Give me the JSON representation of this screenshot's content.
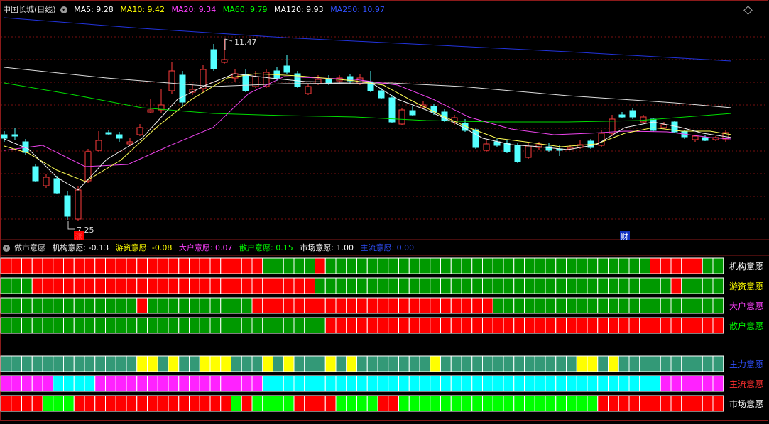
{
  "header": {
    "stock": "中国长城(日线)",
    "ma": [
      {
        "label": "MA5: 9.28",
        "color": "#ffffff"
      },
      {
        "label": "MA10: 9.42",
        "color": "#ffff00"
      },
      {
        "label": "MA20: 9.34",
        "color": "#ff40ff"
      },
      {
        "label": "MA60: 9.79",
        "color": "#00ff00"
      },
      {
        "label": "MA120: 9.93",
        "color": "#ffffff"
      },
      {
        "label": "MA250: 10.97",
        "color": "#3050ff"
      }
    ]
  },
  "main_chart": {
    "high_label": "11.47",
    "low_label": "7.25",
    "markers": [
      {
        "text": "涨",
        "color": "#ff4040"
      },
      {
        "text": "财",
        "color": "#ffffff"
      }
    ]
  },
  "indicator": {
    "name": "做市意愿",
    "items": [
      {
        "label": "机构意愿: -0.13",
        "color": "#ffffff"
      },
      {
        "label": "游资意愿: -0.08",
        "color": "#ffff00"
      },
      {
        "label": "大户意愿: 0.07",
        "color": "#ff40ff"
      },
      {
        "label": "散户意愿: 0.15",
        "color": "#00ff00"
      },
      {
        "label": "市场意愿: 1.00",
        "color": "#ffffff"
      },
      {
        "label": "主流意愿: 0.00",
        "color": "#3050ff"
      }
    ]
  },
  "rows": [
    {
      "label": "机构意愿",
      "color": "#ffffff",
      "pattern": "RRRRRRRRRRRRRRRRRRRRRRRRRGGGGGRGGGGGGGGGGGGGGGGGGGGGGGGGGGGGGGRRRRRGGGGGGGGGG"
    },
    {
      "label": "游资意愿",
      "color": "#ffff00",
      "pattern": "GGGRRRRRRRRRRRRRRRRRRRRRRRRRRRGGGGGGGGGGGGGGGGGGGGGGGGGGGGGGGGGGRGGGGGGGGGGGGG"
    },
    {
      "label": "大户意愿",
      "color": "#ff40ff",
      "pattern": "GGGGGGGGGGGGGRGGGGGGGGGGRRRRRRRRRRRRRRRRRRRRRRRGGGGGGGGGGGGGGGGGGGGGGGGGGGGRRRG"
    },
    {
      "label": "散户意愿",
      "color": "#00ff00",
      "pattern": "GGGGGGGGGGGGGGGGGGGGGGGGGGGGGGGRRRRRRRRRRRRRRRRRRRRRRRRRRRRRRRRRRRRRRRRRRGGGGGGG"
    },
    {
      "label": "主力意愿",
      "color": "#3050ff",
      "pattern": "TTTTTTTTTTTTTYYTYTTYYYTTTYTYTTTYTYTTTTTTTYTTTTTTTTTTTTTYYTYTTTTTTTTTTTTTTTTTTTTT"
    },
    {
      "label": "主流意愿",
      "color": "#ff3030",
      "pattern": "MMMMMCCCCMMMMMMMMMMMMMMMMCCCCCCCCCCCCCCCCCCCCCCCCCCCCCCCCCCCCCCMMMMMMMMMMMMCCC"
    },
    {
      "label": "市场意愿",
      "color": "#ffffff",
      "pattern": "RRRRLLLRRRRRRRRRRRRRRRLRLLLLRRRRLLLLRRLLLLLLLLLLLLLLLLLLLRRRRRRRRRRRRRRRRLLLLLLL"
    }
  ],
  "colors": {
    "R": "#ff0000",
    "G": "#009900",
    "T": "#339977",
    "Y": "#ffff00",
    "M": "#ff22ff",
    "C": "#00ffff",
    "L": "#00ff00"
  }
}
